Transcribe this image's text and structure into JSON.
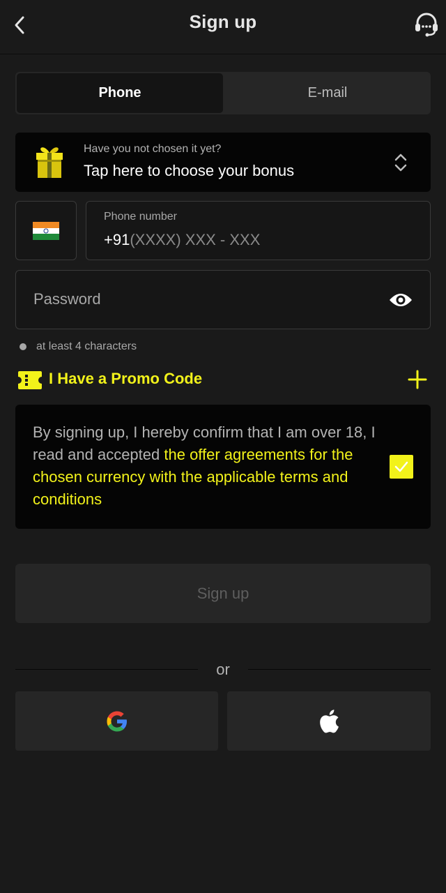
{
  "header": {
    "title": "Sign up",
    "back_icon": "chevron-left-icon",
    "support_icon": "headset-support-icon"
  },
  "tabs": [
    {
      "label": "Phone",
      "active": true
    },
    {
      "label": "E-mail",
      "active": false
    }
  ],
  "bonus": {
    "hint": "Have you not chosen it yet?",
    "main": "Tap here to choose your bonus",
    "icon": "gift-icon",
    "selector_icon": "chevron-updown-icon"
  },
  "phone": {
    "country_flag": "india-flag-icon",
    "label": "Phone number",
    "prefix": "+91",
    "mask": "(XXXX) XXX - XXX"
  },
  "password": {
    "placeholder": "Password",
    "icon": "eye-icon"
  },
  "requirements": [
    "at least 4 characters"
  ],
  "promo": {
    "label": "I Have a Promo Code",
    "icon": "ticket-icon"
  },
  "terms": {
    "text_plain": "By signing up, I hereby confirm that I am over 18, I read and accepted ",
    "text_link": "the offer agreements for the chosen currency with the applicable terms and conditions",
    "checked": true
  },
  "signup_button": "Sign up",
  "divider_text": "or",
  "social": [
    {
      "name": "google",
      "icon": "google-icon"
    },
    {
      "name": "apple",
      "icon": "apple-icon"
    }
  ],
  "colors": {
    "accent": "#f2f21a",
    "background": "#1a1a1a",
    "panel": "#050505",
    "button": "#262626"
  }
}
